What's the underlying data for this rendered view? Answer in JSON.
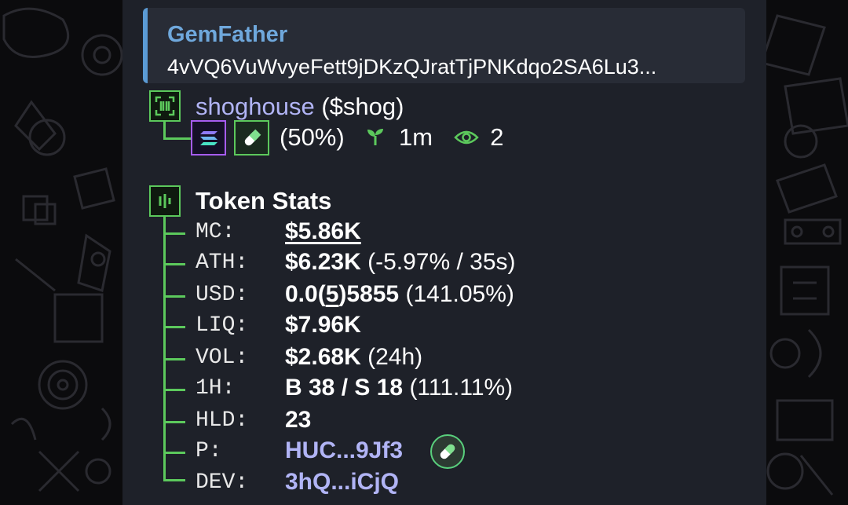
{
  "reply": {
    "sender": "GemFather",
    "preview": "4vVQ6VuWvyeFett9jDKzQJratTjPNKdqo2SA6Lu3..."
  },
  "token": {
    "name": "shoghouse",
    "ticker": "($shog)",
    "percent": "(50%)",
    "age": "1m",
    "views": "2"
  },
  "stats": {
    "title": "Token Stats",
    "mc": {
      "label": "MC:",
      "value": "$5.86K"
    },
    "ath": {
      "label": "ATH:",
      "value": "$6.23K",
      "extra": "(-5.97% / 35s)"
    },
    "usd": {
      "label": "USD:",
      "prefix": "0.0(",
      "zeros": "5",
      "suffix": ")5855",
      "extra": "(141.05%)"
    },
    "liq": {
      "label": "LIQ:",
      "value": "$7.96K"
    },
    "vol": {
      "label": "VOL:",
      "value": "$2.68K",
      "extra": "(24h)"
    },
    "h1": {
      "label": "1H:",
      "value": "B 38 / S 18",
      "extra": "(111.11%)"
    },
    "hld": {
      "label": "HLD:",
      "value": "23"
    },
    "pair": {
      "label": "P:",
      "value": "HUC...9Jf3"
    },
    "dev": {
      "label": "DEV:",
      "value": "3hQ...iCjQ"
    }
  },
  "colors": {
    "bubble": "#1e2129",
    "tree": "#5cc95c",
    "link": "#b1b4f5",
    "reply_accent": "#5b9bd5"
  },
  "icons": [
    "scan-icon",
    "solana-icon",
    "pill-icon",
    "sprout-icon",
    "eye-icon",
    "bar-chart-icon"
  ]
}
